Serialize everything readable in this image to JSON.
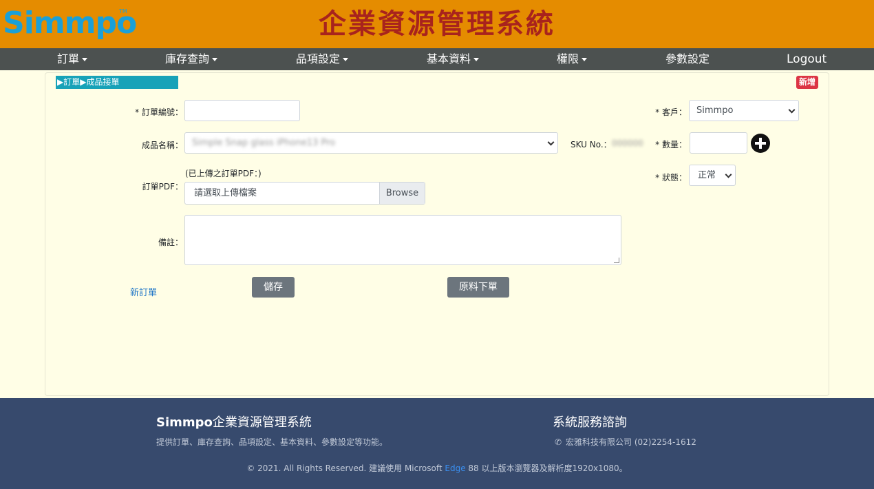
{
  "header": {
    "logo": "Simmpo",
    "tm": "TM",
    "title": "企業資源管理系統"
  },
  "nav": {
    "orders": "訂單",
    "inventory": "庫存查詢",
    "items": "品項設定",
    "basic": "基本資料",
    "permission": "權限",
    "params": "參數設定",
    "logout": "Logout"
  },
  "page": {
    "breadcrumb": "▶訂單▶成品接單",
    "new_badge": "新增",
    "order_no_label": "* 訂單編號：",
    "order_no_value": "",
    "product_label": "成品名稱：",
    "product_value": "Simple Snap glass iPhone13 Pro",
    "sku_label": "SKU No.：",
    "sku_value": "000000",
    "pdf_note": "(已上傳之訂單PDF：)",
    "pdf_label": "訂單PDF：",
    "pdf_placeholder": "請選取上傳檔案",
    "browse": "Browse",
    "remark_label": "備註：",
    "remark_value": "",
    "customer_label": "* 客戶：",
    "customer_value": "Simmpo",
    "qty_label": "* 數量：",
    "qty_value": "",
    "status_label": "* 狀態：",
    "status_value": "正常",
    "new_order_link": "新訂單",
    "save_button": "儲存",
    "material_order_button": "原料下單"
  },
  "footer": {
    "brand_bold": "Simmpo",
    "brand_rest": "企業資源管理系統",
    "desc": "提供訂單、庫存查詢、品項設定、基本資料、參數設定等功能。",
    "service_title": "系統服務諮詢",
    "contact": "宏雅科技有限公司 (02)2254-1612",
    "copy_pre": "© 2021. All Rights Reserved. 建議使用 Microsoft ",
    "copy_edge": "Edge",
    "copy_post": " 88 以上版本瀏覽器及解析度1920x1080。"
  }
}
